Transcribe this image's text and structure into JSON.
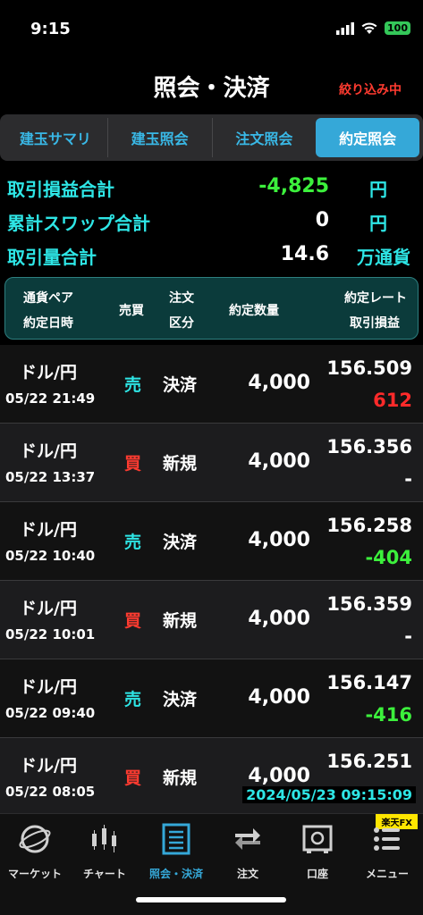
{
  "status": {
    "time": "9:15",
    "battery": "100"
  },
  "header": {
    "title": "照会・決済",
    "filter_badge": "絞り込み中"
  },
  "tabs": [
    "建玉サマリ",
    "建玉照会",
    "注文照会",
    "約定照会"
  ],
  "summary": [
    {
      "label": "取引損益合計",
      "value": "-4,825",
      "unit": "円"
    },
    {
      "label": "累計スワップ合計",
      "value": "0",
      "unit": "円"
    },
    {
      "label": "取引量合計",
      "value": "14.6",
      "unit": "万通貨"
    }
  ],
  "table_header": {
    "pair": "通貨ペア",
    "datetime": "約定日時",
    "side": "売買",
    "order_type_1": "注文",
    "order_type_2": "区分",
    "qty": "約定数量",
    "rate": "約定レート",
    "pnl": "取引損益"
  },
  "rows": [
    {
      "pair": "ドル/円",
      "datetime": "05/22 21:49",
      "side": "売",
      "side_color": "#2ee6e6",
      "type": "決済",
      "qty": "4,000",
      "rate": "156.509",
      "pnl": "612",
      "pnl_color": "#ff2a2a"
    },
    {
      "pair": "ドル/円",
      "datetime": "05/22 13:37",
      "side": "買",
      "side_color": "#ff3b30",
      "type": "新規",
      "qty": "4,000",
      "rate": "156.356",
      "pnl": "-",
      "pnl_color": "#ffffff"
    },
    {
      "pair": "ドル/円",
      "datetime": "05/22 10:40",
      "side": "売",
      "side_color": "#2ee6e6",
      "type": "決済",
      "qty": "4,000",
      "rate": "156.258",
      "pnl": "-404",
      "pnl_color": "#3cf03c"
    },
    {
      "pair": "ドル/円",
      "datetime": "05/22 10:01",
      "side": "買",
      "side_color": "#ff3b30",
      "type": "新規",
      "qty": "4,000",
      "rate": "156.359",
      "pnl": "-",
      "pnl_color": "#ffffff"
    },
    {
      "pair": "ドル/円",
      "datetime": "05/22 09:40",
      "side": "売",
      "side_color": "#2ee6e6",
      "type": "決済",
      "qty": "4,000",
      "rate": "156.147",
      "pnl": "-416",
      "pnl_color": "#3cf03c"
    },
    {
      "pair": "ドル/円",
      "datetime": "05/22 08:05",
      "side": "買",
      "side_color": "#ff3b30",
      "type": "新規",
      "qty": "4,000",
      "rate": "156.251",
      "pnl": "",
      "pnl_color": "#ffffff"
    }
  ],
  "timestamp": "2024/05/23 09:15:09",
  "brand": "楽天FX",
  "tabbar": [
    {
      "label": "マーケット",
      "icon": "globe-icon"
    },
    {
      "label": "チャート",
      "icon": "candlestick-icon"
    },
    {
      "label": "照会・決済",
      "icon": "list-icon"
    },
    {
      "label": "注文",
      "icon": "order-icon"
    },
    {
      "label": "口座",
      "icon": "safe-icon"
    },
    {
      "label": "メニュー",
      "icon": "menu-icon"
    }
  ]
}
